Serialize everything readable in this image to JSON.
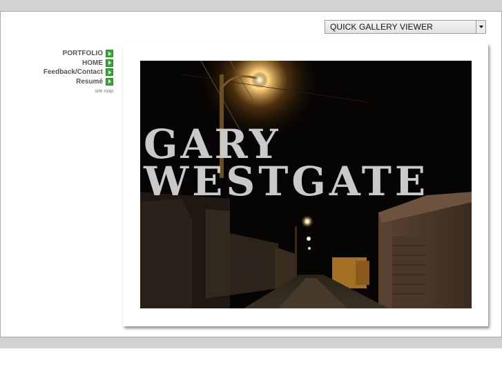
{
  "header": {
    "gallery_select": {
      "value": "QUICK GALLERY VIEWER"
    }
  },
  "nav": {
    "items": [
      {
        "label": "PORTFOLIO"
      },
      {
        "label": "HOME"
      },
      {
        "label": "Feedback/Contact"
      },
      {
        "label": "Resumé"
      }
    ],
    "site_map": "site map"
  },
  "hero": {
    "title_line1": "GARY",
    "title_line2": "WESTGATE"
  },
  "colors": {
    "arrow": "#3aa43a",
    "bands": "#d2d2d2",
    "title_text": "#c9c9c9"
  }
}
